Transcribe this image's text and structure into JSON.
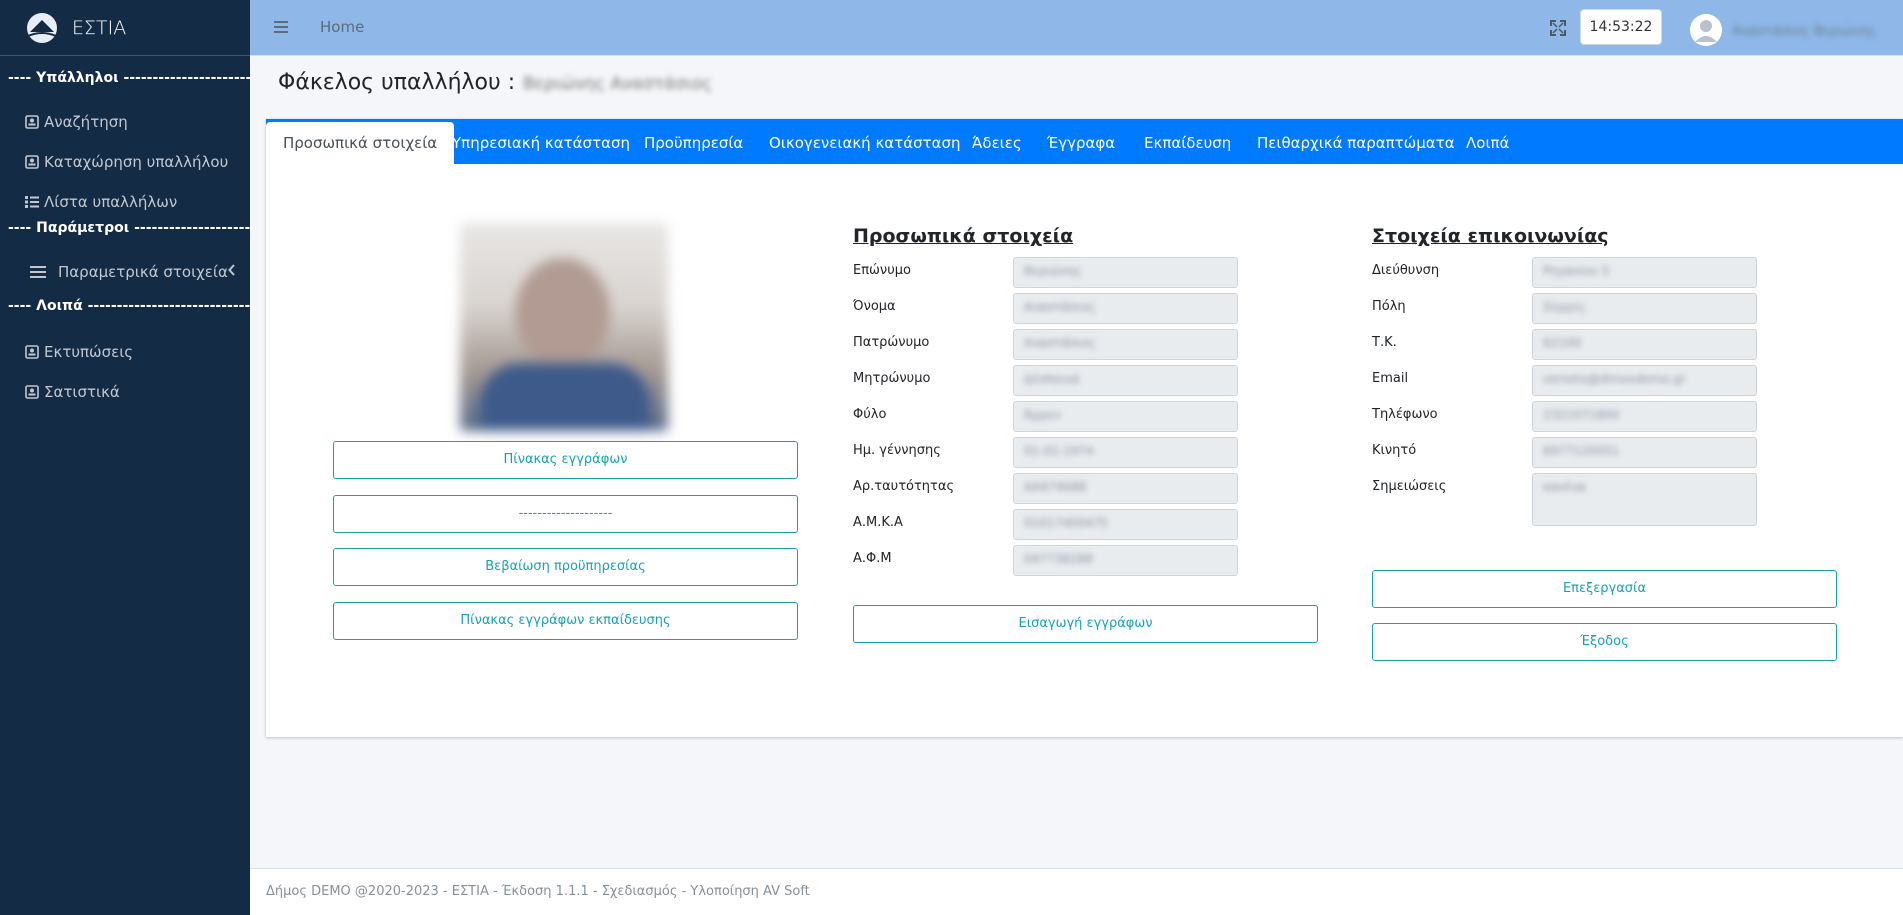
{
  "app": {
    "brand": "ΕΣΤΙΑ"
  },
  "sidebar": {
    "sections": [
      {
        "header": "---- Υπάλληλοι ------------------------"
      },
      {
        "header": "---- Παράμετροι ---------------------"
      },
      {
        "header": "---- Λοιπά -----------------------------"
      }
    ],
    "items": [
      {
        "label": "Αναζήτηση",
        "icon": "id-card-icon"
      },
      {
        "label": "Καταχώρηση υπαλλήλου",
        "icon": "id-card-icon"
      },
      {
        "label": "Λίστα υπαλλήλων",
        "icon": "list-icon"
      },
      {
        "label": "Παραμετρικά στοιχεία",
        "icon": "bars-icon"
      },
      {
        "label": "Εκτυπώσεις",
        "icon": "id-card-icon"
      },
      {
        "label": "Σατιστικά",
        "icon": "id-card-icon"
      }
    ]
  },
  "topbar": {
    "home": "Home",
    "clock": "14:53:22",
    "user_name": "Αναστάσιος Βεριώνης"
  },
  "page": {
    "title": "Φάκελος υπαλλήλου :",
    "employee_name": "Βεριώνης Αναστάσιος"
  },
  "tabs": [
    "Προσωπικά στοιχεία",
    "Υπηρεσιακή κατάσταση",
    "Προϋπηρεσία",
    "Οικογενειακή κατάσταση",
    "Άδειες",
    "Έγγραφα",
    "Εκπαίδευση",
    "Πειθαρχικά παραπτώματα",
    "Λοιπά"
  ],
  "left_buttons": [
    "Πίνακας εγγράφων",
    "--------------------",
    "Βεβαίωση προϋπηρεσίας",
    "Πίνακας εγγράφων εκπαίδευσης"
  ],
  "personal": {
    "title": "Προσωπικά στοιχεία",
    "fields": [
      {
        "label": "Επώνυμο",
        "value": "Βεριώνης"
      },
      {
        "label": "Όνομα",
        "value": "Αναστάσιος"
      },
      {
        "label": "Πατρώνυμο",
        "value": "Αναστάσιος"
      },
      {
        "label": "Μητρώνυμο",
        "value": "Δέσποινα"
      },
      {
        "label": "Φύλο",
        "value": "Άρρεν"
      },
      {
        "label": "Ημ. γέννησης",
        "value": "01-01-1974"
      },
      {
        "label": "Αρ.ταυτότητας",
        "value": "ΑΑ474688"
      },
      {
        "label": "Α.Μ.Κ.Α",
        "value": "01017400475"
      },
      {
        "label": "Α.Φ.Μ",
        "value": "047738288"
      }
    ],
    "button": "Εισαγωγή εγγράφων"
  },
  "contact": {
    "title": "Στοιχεία επικοινωνίας",
    "fields": [
      {
        "label": "Διεύθυνση",
        "value": "Ρηγανίου 5"
      },
      {
        "label": "Πόλη",
        "value": "Σέρρες"
      },
      {
        "label": "Τ.Κ.",
        "value": "62100"
      },
      {
        "label": "Email",
        "value": "veriotis@dimosdemo.gr"
      },
      {
        "label": "Τηλέφωνο",
        "value": "2321071800"
      },
      {
        "label": "Κινητό",
        "value": "6977120051"
      },
      {
        "label": "Σημειώσεις",
        "value": "κανένα"
      }
    ],
    "edit_button": "Επεξεργασία",
    "exit_button": "Έξοδος"
  },
  "footer": {
    "text": "Δήμος DEMO @2020-2023 - ΕΣΤΙΑ - Έκδοση 1.1.1 - Σχεδιασμός - Υλοποίηση AV Soft"
  },
  "colors": {
    "sidebar_bg": "#142b45",
    "topbar_bg": "#8fb8e9",
    "tabbar_bg": "#007bff",
    "outline_button": "#17a2b8"
  }
}
